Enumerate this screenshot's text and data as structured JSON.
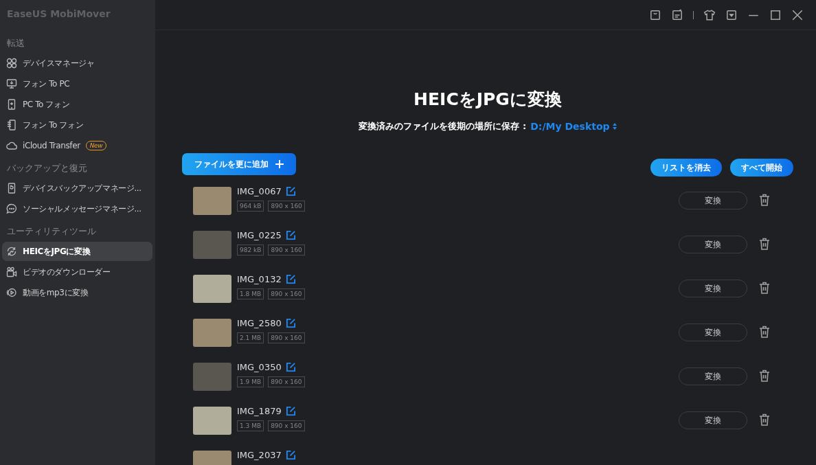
{
  "app_title": "EaseUS MobiMover",
  "sidebar": {
    "sections": [
      {
        "heading": "転送",
        "items": [
          {
            "label": "デバイスマネージャ",
            "selected": false
          },
          {
            "label": "フォン To PC",
            "selected": false
          },
          {
            "label": "PC To フォン",
            "selected": false
          },
          {
            "label": "フォン To フォン",
            "selected": false
          },
          {
            "label": "iCloud Transfer",
            "badge": "New",
            "selected": false
          }
        ]
      },
      {
        "heading": "バックアップと復元",
        "items": [
          {
            "label": "デバイスバックアップマネージ...",
            "selected": false
          },
          {
            "label": "ソーシャルメッセージマネージ...",
            "selected": false
          }
        ]
      },
      {
        "heading": "ユーティリティツール",
        "items": [
          {
            "label": "HEICをJPGに変換",
            "selected": true
          },
          {
            "label": "ビデオのダウンローダー",
            "selected": false
          },
          {
            "label": "動画をmp3に変換",
            "selected": false
          }
        ]
      }
    ]
  },
  "title": "HEICをJPGに変換",
  "save_location": {
    "label": "変換済みのファイルを後期の場所に保存 :",
    "path": "D:/My Desktop"
  },
  "add_button": "ファイルを更に追加",
  "clear_button": "リストを消去",
  "start_all_button": "すべて開始",
  "files": [
    {
      "name": "IMG_0067",
      "size": "964 kB",
      "dimensions": "890 x 160",
      "convert": "変換"
    },
    {
      "name": "IMG_0225",
      "size": "982 kB",
      "dimensions": "890 x 160",
      "convert": "変換"
    },
    {
      "name": "IMG_0132",
      "size": "1.8 MB",
      "dimensions": "890 x 160",
      "convert": "変換"
    },
    {
      "name": "IMG_2580",
      "size": "2.1 MB",
      "dimensions": "890 x 160",
      "convert": "変換"
    },
    {
      "name": "IMG_0350",
      "size": "1.9 MB",
      "dimensions": "890 x 160",
      "convert": "変換"
    },
    {
      "name": "IMG_1879",
      "size": "1.3 MB",
      "dimensions": "890 x 160",
      "convert": "変換"
    },
    {
      "name": "IMG_2037"
    }
  ]
}
